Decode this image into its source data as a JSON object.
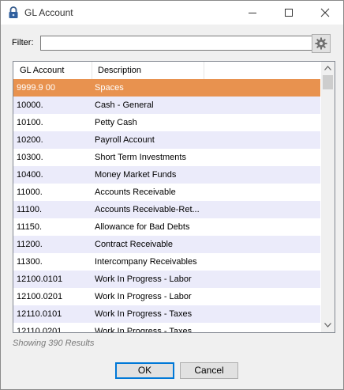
{
  "window": {
    "title": "GL Account"
  },
  "filter": {
    "label": "Filter:",
    "value": "",
    "placeholder": ""
  },
  "grid": {
    "columns": [
      "GL Account",
      "Description"
    ],
    "rows": [
      {
        "account": "9999.9 00",
        "description": "Spaces",
        "selected": true
      },
      {
        "account": "10000.",
        "description": "Cash - General"
      },
      {
        "account": "10100.",
        "description": "Petty Cash"
      },
      {
        "account": "10200.",
        "description": "Payroll Account"
      },
      {
        "account": "10300.",
        "description": "Short Term Investments"
      },
      {
        "account": "10400.",
        "description": "Money Market Funds"
      },
      {
        "account": "11000.",
        "description": "Accounts Receivable"
      },
      {
        "account": "11100.",
        "description": "Accounts Receivable-Ret..."
      },
      {
        "account": "11150.",
        "description": "Allowance for Bad Debts"
      },
      {
        "account": "11200.",
        "description": "Contract Receivable"
      },
      {
        "account": "11300.",
        "description": "Intercompany Receivables"
      },
      {
        "account": "12100.0101",
        "description": "Work In Progress - Labor"
      },
      {
        "account": "12100.0201",
        "description": "Work In Progress - Labor"
      },
      {
        "account": "12110.0101",
        "description": "Work In Progress - Taxes"
      },
      {
        "account": "12110.0201",
        "description": "Work In Progress - Taxes"
      }
    ]
  },
  "status": {
    "results_text": "Showing 390 Results"
  },
  "buttons": {
    "ok": "OK",
    "cancel": "Cancel"
  },
  "icons": {
    "app": "lock-icon",
    "settings": "gear-icon",
    "minimize": "minimize-icon",
    "maximize": "maximize-icon",
    "close": "close-icon"
  },
  "colors": {
    "selection": "#e8924f",
    "alt_row": "#ebebfa"
  }
}
